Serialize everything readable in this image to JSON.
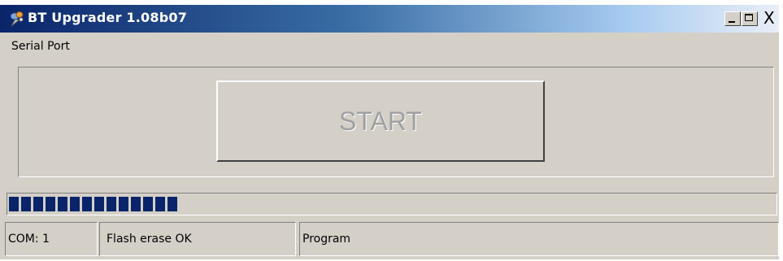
{
  "window": {
    "title": "BT Upgrader 1.08b07",
    "icon": "bluetooth-app-icon",
    "controls": [
      "minimize-icon",
      "maximize-icon",
      "close-icon"
    ],
    "close_glyph": "X"
  },
  "menu": {
    "items": [
      {
        "label": "Serial Port"
      }
    ]
  },
  "main": {
    "start_button_label": "START",
    "start_button_state": "disabled"
  },
  "progress": {
    "value": 0.225
  },
  "status": {
    "port": "COM: 1",
    "message": "Flash erase OK",
    "mode": "Program"
  },
  "colors": {
    "title_gradient_start": "#0a246a",
    "title_gradient_end": "#a6caf0",
    "face": "#d4d0c8",
    "progress_fill": "#0a246a",
    "disabled_text": "#a0a0a0"
  }
}
